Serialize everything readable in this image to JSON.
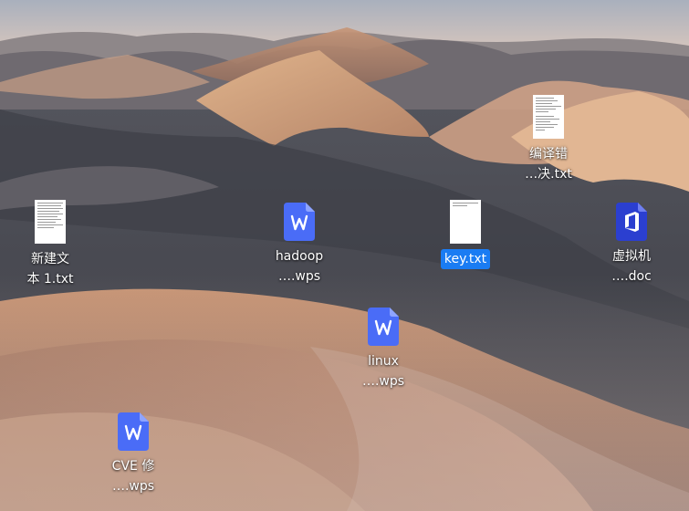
{
  "desktop": {
    "icons": [
      {
        "name": "text-file",
        "line1": "编译错",
        "line2": "…决.txt"
      },
      {
        "name": "text-file",
        "line1": "新建文",
        "line2": "本 1.txt"
      },
      {
        "name": "wps-file",
        "line1": "hadoop",
        "line2": "….wps"
      },
      {
        "name": "text-file",
        "line1": "key.txt",
        "line2": "",
        "selected": true
      },
      {
        "name": "doc-file",
        "line1": "虚拟机",
        "line2": "….doc"
      },
      {
        "name": "wps-file",
        "line1": "linux",
        "line2": "….wps"
      },
      {
        "name": "wps-file",
        "line1": "CVE 修",
        "line2": "….wps"
      }
    ]
  },
  "colors": {
    "selection": "#1a7cf3",
    "wps_icon": "#4a6cf7",
    "doc_icon": "#2b3fd0"
  }
}
